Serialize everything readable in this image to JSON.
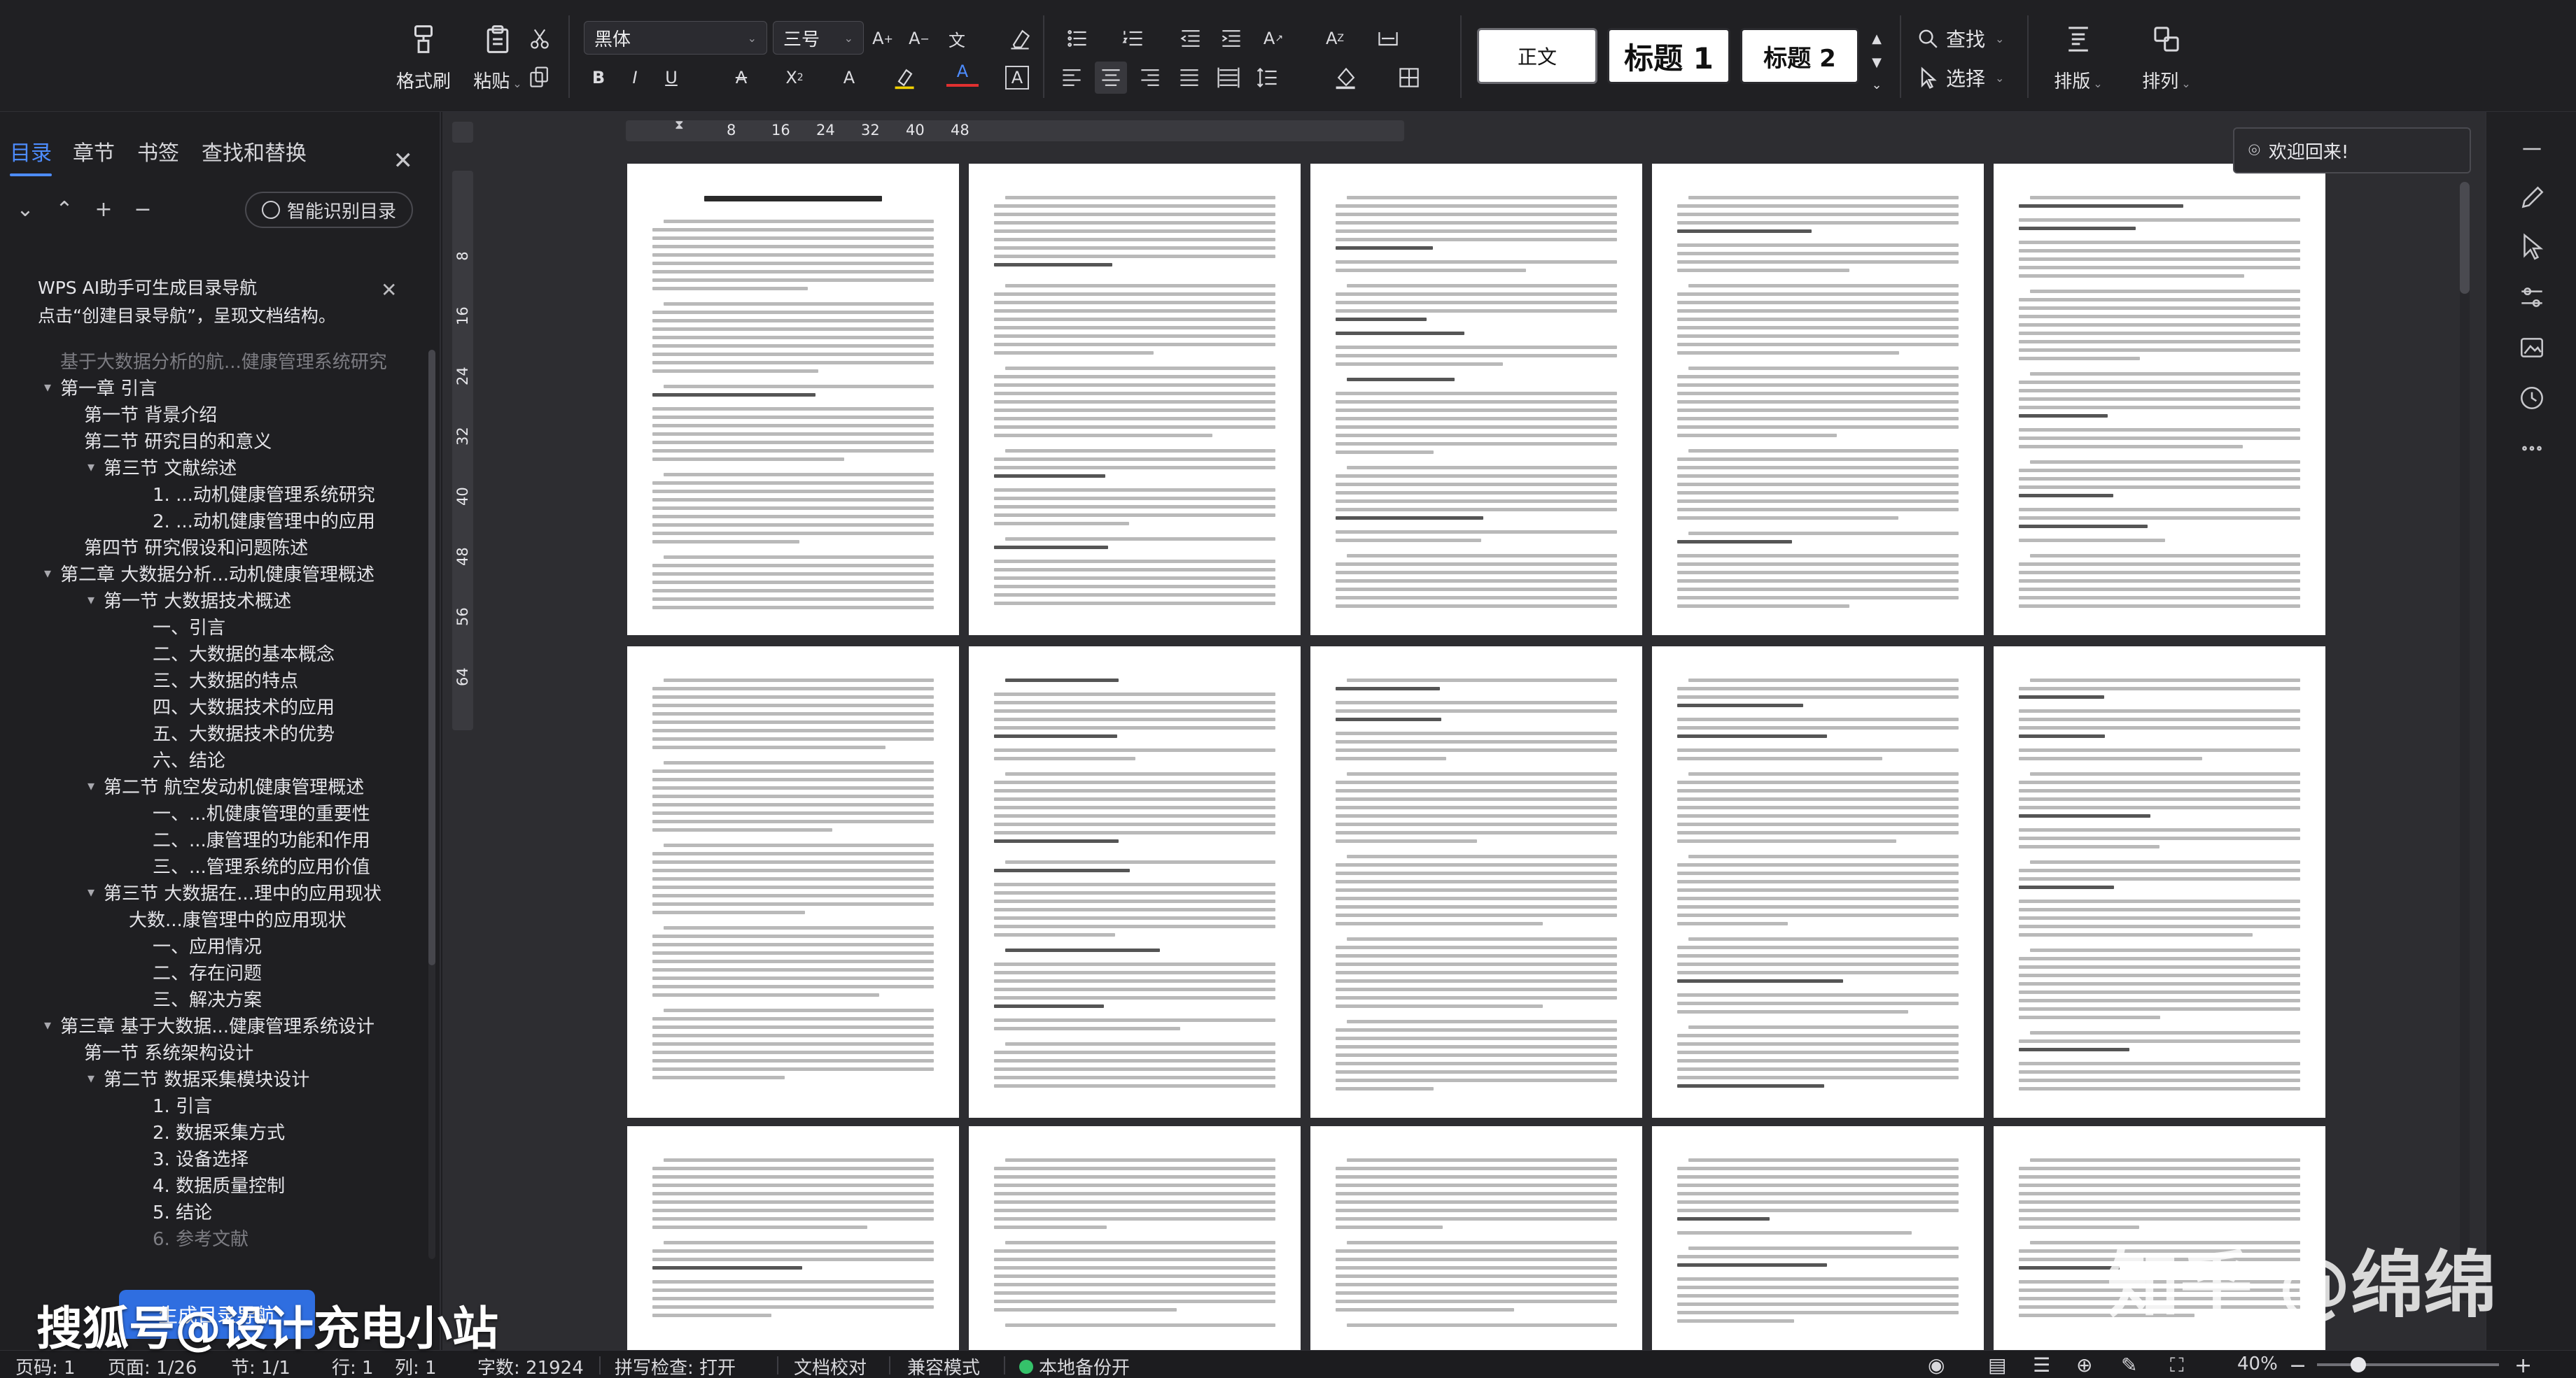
{
  "ribbon": {
    "format_painter": "格式刷",
    "paste": "粘贴",
    "font_name": "黑体",
    "font_size": "三号",
    "styles": [
      "正文",
      "标题 1",
      "标题 2"
    ],
    "find": "查找",
    "select": "选择",
    "layout": "排版",
    "arrange": "排列"
  },
  "panel": {
    "tabs": [
      "目录",
      "章节",
      "书签",
      "查找和替换"
    ],
    "smart_toc": "智能识别目录",
    "ai_tip_line1": "WPS AI助手可生成目录导航",
    "ai_tip_line2": "点击“创建目录导航”，呈现文档结构。",
    "generate_button": "生成目录导航",
    "toc": [
      {
        "text": "基于大数据分析的航...健康管理系统研究",
        "level": 0,
        "toggle": "",
        "dim": true
      },
      {
        "text": "第一章 引言",
        "level": 0,
        "toggle": "▾"
      },
      {
        "text": "第一节 背景介绍",
        "level": 1,
        "toggle": ""
      },
      {
        "text": "第二节 研究目的和意义",
        "level": 1,
        "toggle": ""
      },
      {
        "text": "第三节 文献综述",
        "level": 1,
        "toggle": "▾"
      },
      {
        "text": "1. ...动机健康管理系统研究",
        "level": 3,
        "toggle": ""
      },
      {
        "text": "2. ...动机健康管理中的应用",
        "level": 3,
        "toggle": ""
      },
      {
        "text": "第四节 研究假设和问题陈述",
        "level": 1,
        "toggle": ""
      },
      {
        "text": "第二章 大数据分析...动机健康管理概述",
        "level": 0,
        "toggle": "▾"
      },
      {
        "text": "第一节 大数据技术概述",
        "level": 1,
        "toggle": "▾"
      },
      {
        "text": "一、引言",
        "level": 3,
        "toggle": ""
      },
      {
        "text": "二、大数据的基本概念",
        "level": 3,
        "toggle": ""
      },
      {
        "text": "三、大数据的特点",
        "level": 3,
        "toggle": ""
      },
      {
        "text": "四、大数据技术的应用",
        "level": 3,
        "toggle": ""
      },
      {
        "text": "五、大数据技术的优势",
        "level": 3,
        "toggle": ""
      },
      {
        "text": "六、结论",
        "level": 3,
        "toggle": ""
      },
      {
        "text": "第二节 航空发动机健康管理概述",
        "level": 1,
        "toggle": "▾"
      },
      {
        "text": "一、...机健康管理的重要性",
        "level": 3,
        "toggle": ""
      },
      {
        "text": "二、...康管理的功能和作用",
        "level": 3,
        "toggle": ""
      },
      {
        "text": "三、...管理系统的应用价值",
        "level": 3,
        "toggle": ""
      },
      {
        "text": "第三节 大数据在...理中的应用现状",
        "level": 1,
        "toggle": "▾"
      },
      {
        "text": "大数...康管理中的应用现状",
        "level": 2,
        "toggle": ""
      },
      {
        "text": "一、应用情况",
        "level": 3,
        "toggle": ""
      },
      {
        "text": "二、存在问题",
        "level": 3,
        "toggle": ""
      },
      {
        "text": "三、解决方案",
        "level": 3,
        "toggle": ""
      },
      {
        "text": "第三章 基于大数据...健康管理系统设计",
        "level": 0,
        "toggle": "▾"
      },
      {
        "text": "第一节 系统架构设计",
        "level": 1,
        "toggle": ""
      },
      {
        "text": "第二节 数据采集模块设计",
        "level": 1,
        "toggle": "▾"
      },
      {
        "text": "1. 引言",
        "level": 3,
        "toggle": ""
      },
      {
        "text": "2. 数据采集方式",
        "level": 3,
        "toggle": ""
      },
      {
        "text": "3. 设备选择",
        "level": 3,
        "toggle": ""
      },
      {
        "text": "4. 数据质量控制",
        "level": 3,
        "toggle": ""
      },
      {
        "text": "5. 结论",
        "level": 3,
        "toggle": ""
      },
      {
        "text": "6. 参考文献",
        "level": 3,
        "toggle": "",
        "dim": true
      }
    ]
  },
  "ruler": {
    "h_ticks": [
      "8",
      "16",
      "24",
      "32",
      "40",
      "48"
    ],
    "v_ticks": [
      "8",
      "16",
      "24",
      "32",
      "40",
      "48",
      "56",
      "64"
    ]
  },
  "welcome": "欢迎回来!",
  "status": {
    "page_count": "页码: 1",
    "page": "页面: 1/26",
    "section": "节: 1/1",
    "row": "行: 1",
    "col": "列: 1",
    "words": "字数: 21924",
    "spell": "拼写检查: 打开",
    "proof": "文档校对",
    "compat": "兼容模式",
    "backup": "本地备份开",
    "zoom": "40%"
  },
  "watermarks": {
    "left": "搜狐号@设计充电小站",
    "right": "知乎 @绵绵"
  },
  "colors": {
    "accent": "#4d8cff",
    "ribbon_bg": "#202023",
    "canvas_bg": "#2d2d31",
    "backup_dot": "#35c26a"
  }
}
